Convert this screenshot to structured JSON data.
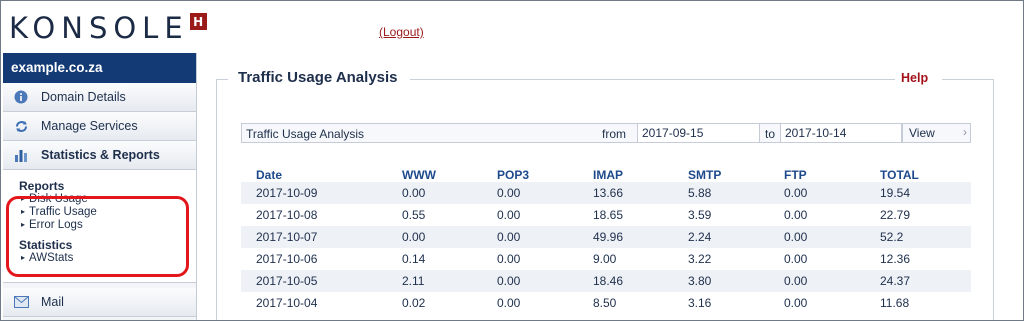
{
  "app": {
    "logo_text": "KONSOLE",
    "logo_badge": "H",
    "logout": "(Logout)"
  },
  "sidebar": {
    "domain": "example.co.za",
    "items": [
      {
        "label": "Domain Details",
        "icon": "info-icon"
      },
      {
        "label": "Manage Services",
        "icon": "refresh-icon"
      },
      {
        "label": "Statistics & Reports",
        "icon": "bar-chart-icon"
      }
    ],
    "reports_heading": "Reports",
    "reports": [
      "Disk Usage",
      "Traffic Usage",
      "Error Logs"
    ],
    "statistics_heading": "Statistics",
    "statistics": [
      "AWStats"
    ],
    "mail": {
      "label": "Mail",
      "icon": "mail-icon"
    }
  },
  "main": {
    "title": "Traffic Usage Analysis",
    "help": "Help",
    "toolbar": {
      "label": "Traffic Usage Analysis",
      "from_label": "from",
      "from_value": "2017-09-15",
      "to_label": "to",
      "to_value": "2017-10-14",
      "view": "View"
    },
    "table": {
      "headers": [
        "Date",
        "WWW",
        "POP3",
        "IMAP",
        "SMTP",
        "FTP",
        "TOTAL"
      ],
      "rows": [
        [
          "2017-10-09",
          "0.00",
          "0.00",
          "13.66",
          "5.88",
          "0.00",
          "19.54"
        ],
        [
          "2017-10-08",
          "0.55",
          "0.00",
          "18.65",
          "3.59",
          "0.00",
          "22.79"
        ],
        [
          "2017-10-07",
          "0.00",
          "0.00",
          "49.96",
          "2.24",
          "0.00",
          "52.2"
        ],
        [
          "2017-10-06",
          "0.14",
          "0.00",
          "9.00",
          "3.22",
          "0.00",
          "12.36"
        ],
        [
          "2017-10-05",
          "2.11",
          "0.00",
          "18.46",
          "3.80",
          "0.00",
          "24.37"
        ],
        [
          "2017-10-04",
          "0.02",
          "0.00",
          "8.50",
          "3.16",
          "0.00",
          "11.68"
        ]
      ]
    }
  },
  "colors": {
    "accent": "#143a76",
    "danger": "#a3121b",
    "highlight": "#e3161b"
  }
}
